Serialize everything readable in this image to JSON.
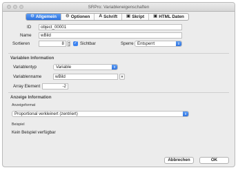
{
  "window": {
    "title": "SRPro: Variableneigenschaften"
  },
  "tabs": [
    {
      "label": "Allgemein",
      "icon": "gear-icon",
      "glyph": "⚙",
      "active": true
    },
    {
      "label": "Optionen",
      "icon": "gear-icon",
      "glyph": "⚙",
      "active": false
    },
    {
      "label": "Schrift",
      "icon": "font-icon",
      "glyph": "A",
      "active": false
    },
    {
      "label": "Skript",
      "icon": "script-icon",
      "glyph": "▣",
      "active": false
    },
    {
      "label": "HTML Daten",
      "icon": "html-icon",
      "glyph": "▣",
      "active": false
    }
  ],
  "general": {
    "id_label": "ID",
    "id_value": "object_00001",
    "name_label": "Name",
    "name_value": "wBild",
    "sort_label": "Sortieren",
    "sort_value": "8",
    "visible_label": "Sichtbar",
    "visible_checked": true,
    "stamp_label": "Sperre",
    "stamp_value": "Entsperrt"
  },
  "variable_info": {
    "section_title": "Variablen Information",
    "type_label": "Variablentyp",
    "type_value": "Variable",
    "name_label": "Variablenname",
    "name_value": "wBild",
    "array_label": "Array Element",
    "array_value": "-2"
  },
  "display_info": {
    "section_title": "Anzeige Information",
    "format_label": "Anzeigeformat",
    "format_value": "Proportional verkleinert (zentriert)",
    "example_label": "Beispiel",
    "example_value": "Kein Beispiel verfügbar"
  },
  "buttons": {
    "cancel": "Abbrechen",
    "ok": "OK"
  }
}
